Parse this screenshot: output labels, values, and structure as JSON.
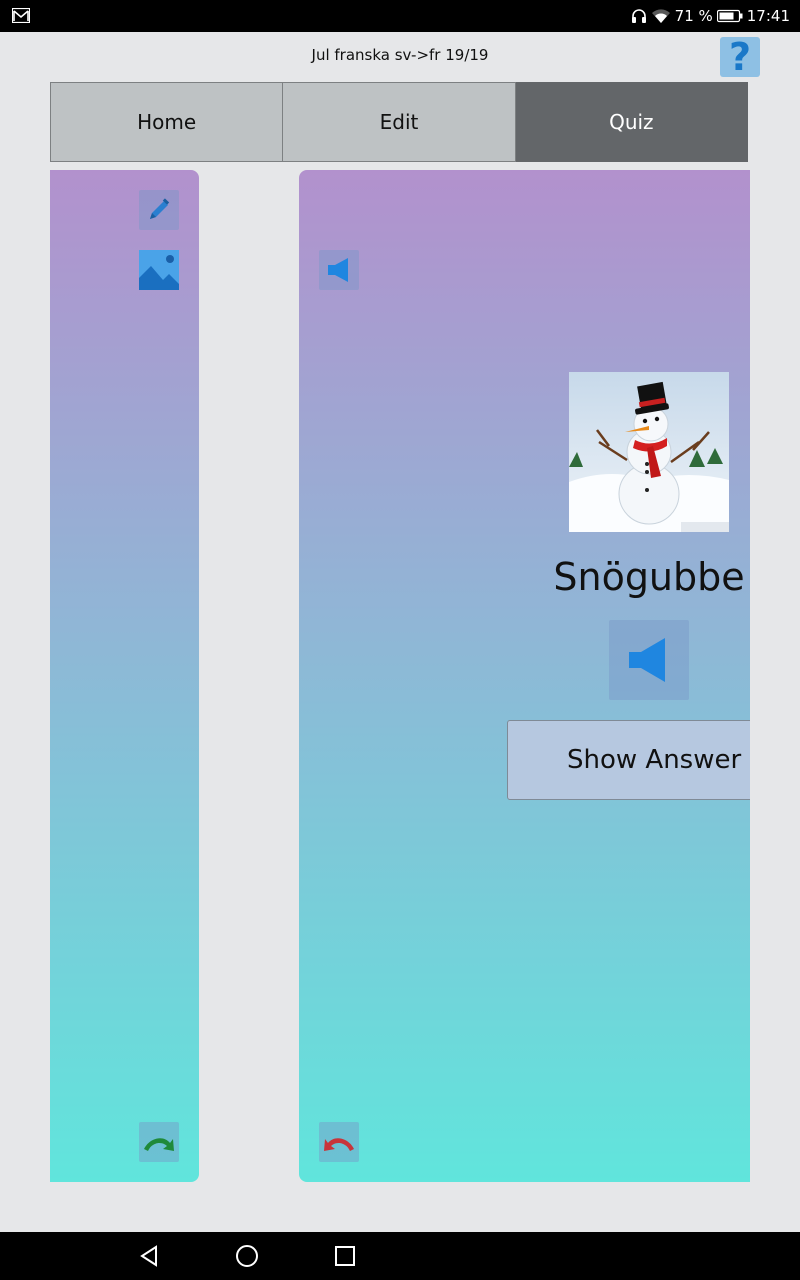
{
  "status_bar": {
    "battery": "71 %",
    "time": "17:41",
    "icons": [
      "gmail-icon",
      "headphones-icon",
      "wifi-icon",
      "battery-icon"
    ]
  },
  "header": {
    "title": "Jul franska sv->fr 19/19",
    "help_label": "?"
  },
  "tabs": [
    {
      "label": "Home",
      "active": false
    },
    {
      "label": "Edit",
      "active": false
    },
    {
      "label": "Quiz",
      "active": true
    }
  ],
  "left_panel": {
    "icons": [
      "pencil-icon",
      "image-icon",
      "undo-arrow-icon"
    ]
  },
  "card": {
    "icons": [
      "speaker-icon",
      "big-speaker-icon",
      "redo-arrow-icon"
    ],
    "image": "snowman-image",
    "word": "Snögubbe",
    "show_answer_label": "Show Answer"
  },
  "nav_bar": {
    "icons": [
      "back-icon",
      "home-icon",
      "recents-icon"
    ]
  },
  "colors": {
    "active_tab": "#636669",
    "tab": "#bec2c4",
    "panel_top": "#b291cd",
    "panel_bottom": "#60e5dc",
    "accent_blue": "#1a78c8"
  }
}
